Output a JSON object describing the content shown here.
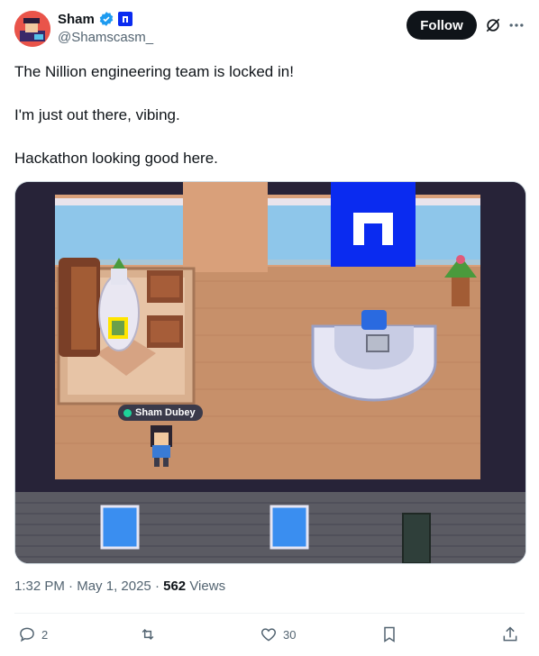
{
  "author": {
    "name": "Sham",
    "handle": "@Shamscasm_"
  },
  "follow_label": "Follow",
  "tweet": {
    "lines": [
      "The Nillion engineering team is locked in!",
      "",
      "I'm just out there, vibing.",
      "",
      "Hackathon looking good here."
    ]
  },
  "media": {
    "player_label": "Sham Dubey",
    "colors": {
      "floor": "#c9926a",
      "wall_window": "#8ec6ea",
      "brand_blue": "#0a2bf0",
      "bricks": "#5a5a62"
    }
  },
  "meta": {
    "time": "1:32 PM",
    "date": "May 1, 2025",
    "views_count": "562",
    "views_label": "Views"
  },
  "actions": {
    "replies": "2",
    "reposts": "",
    "likes": "30"
  },
  "icons": [
    "verified-badge-icon",
    "org-badge-icon",
    "grok-icon",
    "more-icon",
    "reply-icon",
    "repost-icon",
    "like-icon",
    "bookmark-icon",
    "share-icon"
  ]
}
